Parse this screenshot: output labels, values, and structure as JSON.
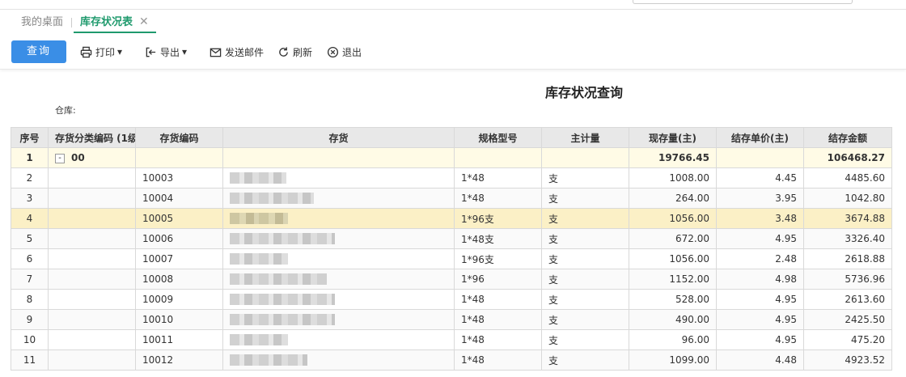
{
  "tabs": {
    "home": "我的桌面",
    "active": "库存状况表",
    "close": "✕"
  },
  "toolbar": {
    "query": "查询",
    "print": "打印",
    "export": "导出",
    "email": "发送邮件",
    "refresh": "刷新",
    "exit": "退出",
    "caret": "▾"
  },
  "report": {
    "title": "库存状况查询",
    "warehouse_label": "仓库:"
  },
  "table": {
    "headers": [
      "序号",
      "存货分类编码 (1级",
      "存货编码",
      "存货",
      "规格型号",
      "主计量",
      "现存量(主)",
      "结存单价(主)",
      "结存金额"
    ],
    "summary": {
      "seq": "1",
      "expand": "-",
      "category": "00",
      "qty": "19766.45",
      "amount": "106468.27"
    },
    "rows": [
      {
        "seq": "2",
        "code": "10003",
        "spec": "1*48",
        "unit": "支",
        "qty": "1008.00",
        "price": "4.45",
        "amount": "4485.60"
      },
      {
        "seq": "3",
        "code": "10004",
        "spec": "1*48",
        "unit": "支",
        "qty": "264.00",
        "price": "3.95",
        "amount": "1042.80"
      },
      {
        "seq": "4",
        "code": "10005",
        "spec": "1*96支",
        "unit": "支",
        "qty": "1056.00",
        "price": "3.48",
        "amount": "3674.88"
      },
      {
        "seq": "5",
        "code": "10006",
        "spec": "1*48支",
        "unit": "支",
        "qty": "672.00",
        "price": "4.95",
        "amount": "3326.40"
      },
      {
        "seq": "6",
        "code": "10007",
        "spec": "1*96支",
        "unit": "支",
        "qty": "1056.00",
        "price": "2.48",
        "amount": "2618.88"
      },
      {
        "seq": "7",
        "code": "10008",
        "spec": "1*96",
        "unit": "支",
        "qty": "1152.00",
        "price": "4.98",
        "amount": "5736.96"
      },
      {
        "seq": "8",
        "code": "10009",
        "spec": "1*48",
        "unit": "支",
        "qty": "528.00",
        "price": "4.95",
        "amount": "2613.60"
      },
      {
        "seq": "9",
        "code": "10010",
        "spec": "1*48",
        "unit": "支",
        "qty": "490.00",
        "price": "4.95",
        "amount": "2425.50"
      },
      {
        "seq": "10",
        "code": "10011",
        "spec": "1*48",
        "unit": "支",
        "qty": "96.00",
        "price": "4.95",
        "amount": "475.20"
      },
      {
        "seq": "11",
        "code": "10012",
        "spec": "1*48",
        "unit": "支",
        "qty": "1099.00",
        "price": "4.48",
        "amount": "4923.52"
      }
    ],
    "selected_seq": "4"
  }
}
